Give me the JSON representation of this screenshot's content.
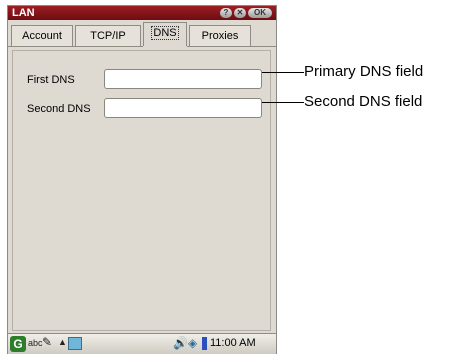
{
  "window": {
    "title": "LAN",
    "help_label": "?",
    "close_label": "✕",
    "ok_label": "OK"
  },
  "tabs": [
    {
      "label": "Account"
    },
    {
      "label": "TCP/IP"
    },
    {
      "label": "DNS"
    },
    {
      "label": "Proxies"
    }
  ],
  "active_tab": "DNS",
  "form": {
    "first_dns": {
      "label": "First DNS",
      "value": ""
    },
    "second_dns": {
      "label": "Second DNS",
      "value": ""
    }
  },
  "taskbar": {
    "start_label": "G",
    "input_mode": "abc",
    "pencil_icon": "✎",
    "arrow_icon": "▲",
    "speaker_icon": "🔊",
    "network_icon": "◈",
    "time": "11:00 AM"
  },
  "callouts": {
    "primary": "Primary DNS field",
    "second": "Second DNS field"
  }
}
